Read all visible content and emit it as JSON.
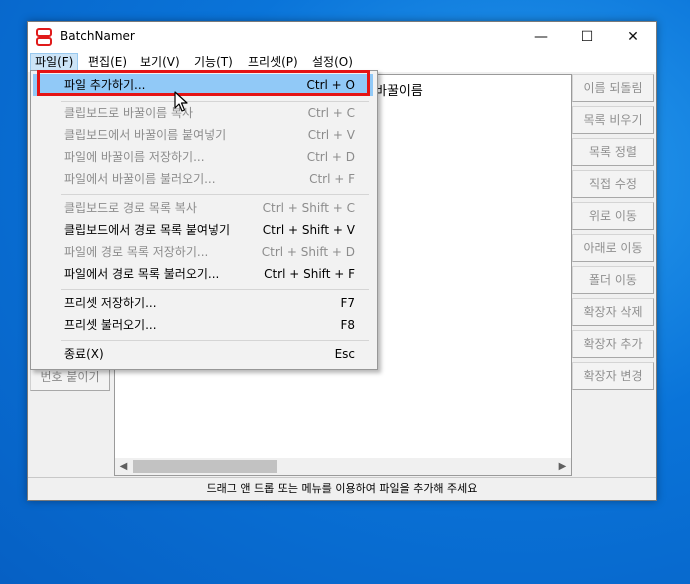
{
  "window": {
    "title": "BatchNamer",
    "controls": {
      "minimize": "—",
      "maximize": "☐",
      "close": "✕"
    },
    "icon_color": "#e01b1b"
  },
  "menubar": [
    {
      "label": "파일(F)"
    },
    {
      "label": "편집(E)"
    },
    {
      "label": "보기(V)"
    },
    {
      "label": "기능(T)"
    },
    {
      "label": "프리셋(P)"
    },
    {
      "label": "설정(O)"
    }
  ],
  "list": {
    "column_header": "바꿀이름"
  },
  "left_panel": {
    "partial_button": "번호 붙이기"
  },
  "right_panel": [
    "이름 되돌림",
    "목록 비우기",
    "목록 정렬",
    "직접 수정",
    "위로 이동",
    "아래로 이동",
    "폴더 이동",
    "확장자 삭제",
    "확장자 추가",
    "확장자 변경"
  ],
  "file_menu": {
    "groups": [
      [
        {
          "label": "파일 추가하기...",
          "shortcut": "Ctrl + O",
          "enabled": true,
          "highlighted": true
        }
      ],
      [
        {
          "label": "클립보드로 바꿀이름 복사",
          "shortcut": "Ctrl + C",
          "enabled": false
        },
        {
          "label": "클립보드에서 바꿀이름 붙여넣기",
          "shortcut": "Ctrl + V",
          "enabled": false
        },
        {
          "label": "파일에 바꿀이름 저장하기...",
          "shortcut": "Ctrl + D",
          "enabled": false
        },
        {
          "label": "파일에서 바꿀이름 불러오기...",
          "shortcut": "Ctrl + F",
          "enabled": false
        }
      ],
      [
        {
          "label": "클립보드로 경로 목록 복사",
          "shortcut": "Ctrl + Shift + C",
          "enabled": false
        },
        {
          "label": "클립보드에서 경로 목록 붙여넣기",
          "shortcut": "Ctrl + Shift + V",
          "enabled": true
        },
        {
          "label": "파일에 경로 목록 저장하기...",
          "shortcut": "Ctrl + Shift + D",
          "enabled": false
        },
        {
          "label": "파일에서 경로 목록 불러오기...",
          "shortcut": "Ctrl + Shift + F",
          "enabled": true
        }
      ],
      [
        {
          "label": "프리셋 저장하기...",
          "shortcut": "F7",
          "enabled": true
        },
        {
          "label": "프리셋 불러오기...",
          "shortcut": "F8",
          "enabled": true
        }
      ],
      [
        {
          "label": "종료(X)",
          "shortcut": "Esc",
          "enabled": true
        }
      ]
    ]
  },
  "statusbar": {
    "text": "드래그 앤 드롭 또는 메뉴를 이용하여 파일을 추가해 주세요"
  },
  "colors": {
    "highlight": "#91c9f7",
    "annotation_box": "#e51414",
    "desktop": "#0a74d9"
  }
}
